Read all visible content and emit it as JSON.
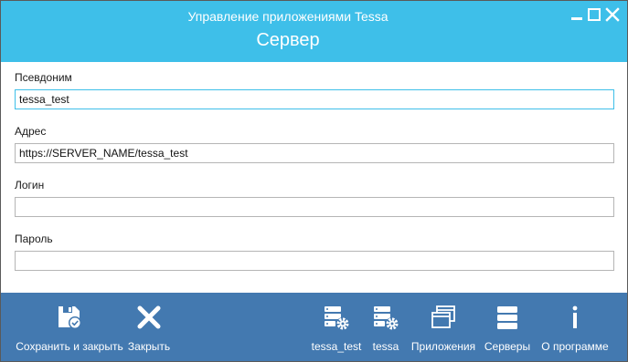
{
  "window": {
    "app_title": "Управление приложениями Tessa",
    "page_title": "Сервер"
  },
  "form": {
    "alias": {
      "label": "Псевдоним",
      "value": "tessa_test"
    },
    "address": {
      "label": "Адрес",
      "value": "https://SERVER_NAME/tessa_test"
    },
    "login": {
      "label": "Логин",
      "value": ""
    },
    "password": {
      "label": "Пароль",
      "value": ""
    }
  },
  "toolbar": {
    "save_close": {
      "label": "Сохранить и закрыть",
      "icon": "save-icon"
    },
    "close": {
      "label": "Закрыть",
      "icon": "close-x-icon"
    },
    "server_tessa_test": {
      "label": "tessa_test",
      "icon": "server-settings-icon"
    },
    "server_tessa": {
      "label": "tessa",
      "icon": "server-settings-icon"
    },
    "applications": {
      "label": "Приложения",
      "icon": "windows-icon"
    },
    "servers": {
      "label": "Серверы",
      "icon": "servers-icon"
    },
    "about": {
      "label": "О программе",
      "icon": "info-icon"
    }
  },
  "colors": {
    "titlebar": "#3ebfe9",
    "toolbar": "#4379b0",
    "focus_border": "#3ebfe9"
  }
}
